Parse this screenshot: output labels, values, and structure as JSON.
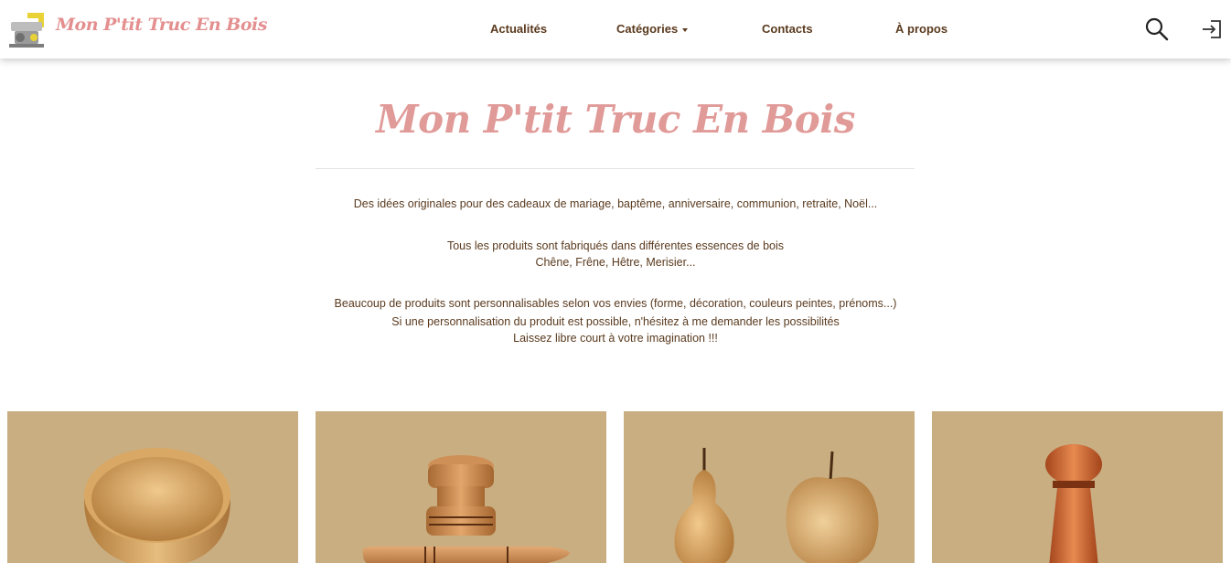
{
  "header": {
    "brand": "Mon P'tit Truc En Bois",
    "nav": [
      {
        "label": "Actualités"
      },
      {
        "label": "Catégories"
      },
      {
        "label": "Contacts"
      },
      {
        "label": "À propos"
      }
    ],
    "icons": [
      "search-icon",
      "login-icon"
    ]
  },
  "hero": {
    "title": "Mon P'tit Truc En Bois",
    "line1": "Des idées originales pour des cadeaux de mariage, baptême, anniversaire, communion, retraite, Noël...",
    "line2a": "Tous les produits sont fabriqués dans différentes essences de bois",
    "line2b": "Chêne, Frêne, Hêtre, Merisier...",
    "line3a": "Beaucoup de produits sont personnalisables selon vos envies (forme, décoration, couleurs peintes, prénoms...)",
    "line3b": "Si une personnalisation du produit est possible, n'hésitez à me demander les possibilités",
    "line3c": "Laissez libre court à votre imagination !!!"
  },
  "products": [
    {
      "image": "wooden-bowl"
    },
    {
      "image": "wooden-stamp-and-rolling-pin"
    },
    {
      "image": "wooden-pear-and-apple"
    },
    {
      "image": "wooden-pepper-mill"
    }
  ],
  "colors": {
    "brand_pink": "#e48f8f",
    "text_brown": "#5a3a1e",
    "card_bg": "#c9ae82"
  }
}
